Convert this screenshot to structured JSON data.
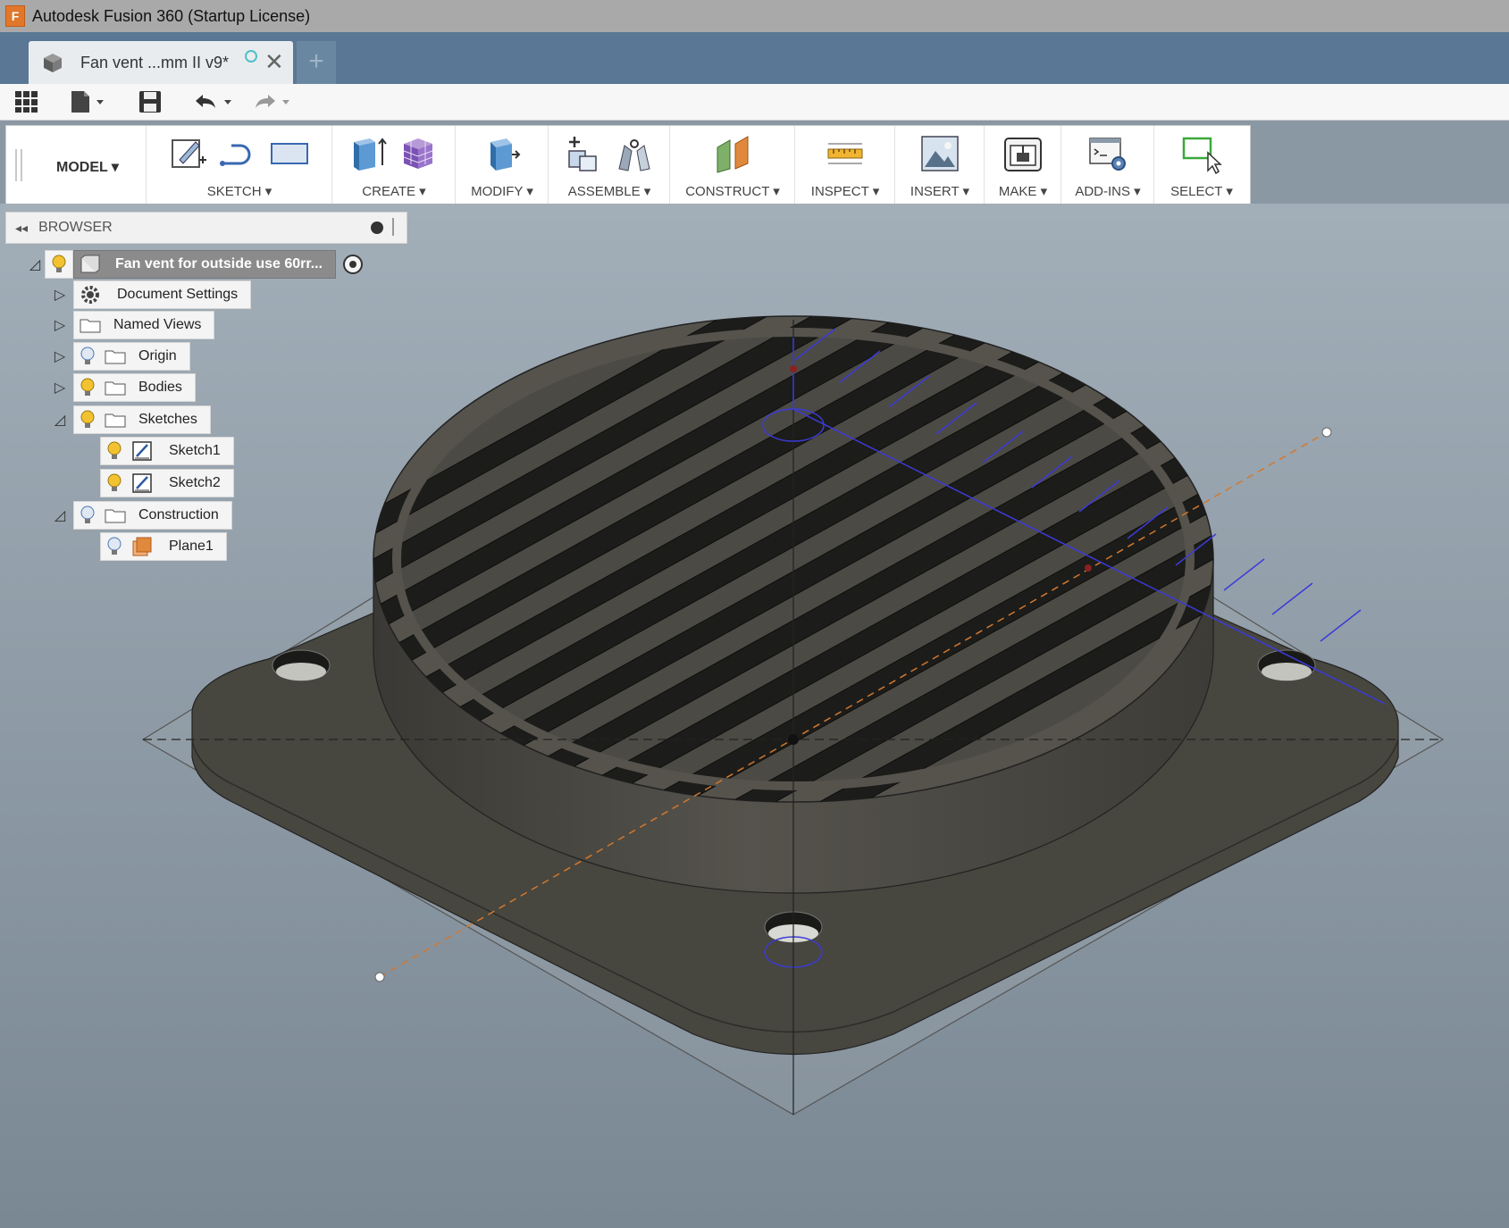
{
  "window": {
    "title": "Autodesk Fusion 360 (Startup License)",
    "logo_letter": "F"
  },
  "tab": {
    "label": "Fan vent ...mm II v9*",
    "close": "✕",
    "new_tab": "+"
  },
  "toolbar": {
    "workspace": "MODEL ▾",
    "groups": [
      {
        "label": "SKETCH ▾"
      },
      {
        "label": "CREATE ▾"
      },
      {
        "label": "MODIFY ▾"
      },
      {
        "label": "ASSEMBLE ▾"
      },
      {
        "label": "CONSTRUCT ▾"
      },
      {
        "label": "INSPECT ▾"
      },
      {
        "label": "INSERT ▾"
      },
      {
        "label": "MAKE ▾"
      },
      {
        "label": "ADD-INS ▾"
      },
      {
        "label": "SELECT ▾"
      }
    ]
  },
  "browser": {
    "title": "BROWSER",
    "collapse": "◂◂",
    "root": "Fan vent for outside use 60rr...",
    "items": [
      {
        "label": "Document Settings"
      },
      {
        "label": "Named Views"
      },
      {
        "label": "Origin"
      },
      {
        "label": "Bodies"
      },
      {
        "label": "Sketches"
      },
      {
        "label": "Sketch1"
      },
      {
        "label": "Sketch2"
      },
      {
        "label": "Construction"
      },
      {
        "label": "Plane1"
      }
    ]
  },
  "colors": {
    "title_bar": "#a9a9a9",
    "tab_bar": "#5a7895",
    "viewport": "#8a98a4",
    "model": "#4a4a45",
    "sketch": "#3b3bd6",
    "axis": "#d2782e"
  }
}
